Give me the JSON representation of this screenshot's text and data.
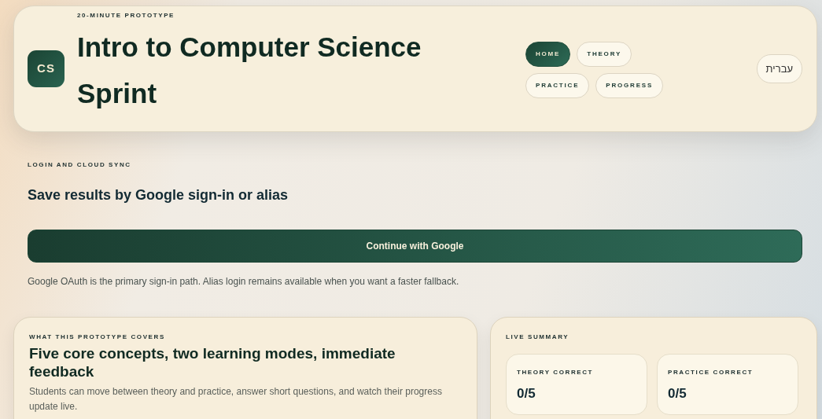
{
  "header": {
    "logo": "CS",
    "eyebrow": "20-MINUTE PROTOTYPE",
    "title": "Intro to Computer Science Sprint",
    "nav": [
      {
        "label": "HOME",
        "selected": true
      },
      {
        "label": "THEORY",
        "selected": false
      },
      {
        "label": "PRACTICE",
        "selected": false
      },
      {
        "label": "PROGRESS",
        "selected": false
      }
    ],
    "language_button": "עברית"
  },
  "login": {
    "eyebrow": "LOGIN AND CLOUD SYNC",
    "heading": "Save results by Google sign-in or alias",
    "button": "Continue with Google",
    "note": "Google OAuth is the primary sign-in path. Alias login remains available when you want a faster fallback."
  },
  "overview": {
    "eyebrow": "WHAT THIS PROTOTYPE COVERS",
    "heading": "Five core concepts, two learning modes, immediate feedback",
    "text": "Students can move between theory and practice, answer short questions, and watch their progress update live."
  },
  "summary": {
    "eyebrow": "LIVE SUMMARY",
    "stats": [
      {
        "label": "THEORY CORRECT",
        "value": "0/5"
      },
      {
        "label": "PRACTICE CORRECT",
        "value": "0/5"
      }
    ]
  }
}
